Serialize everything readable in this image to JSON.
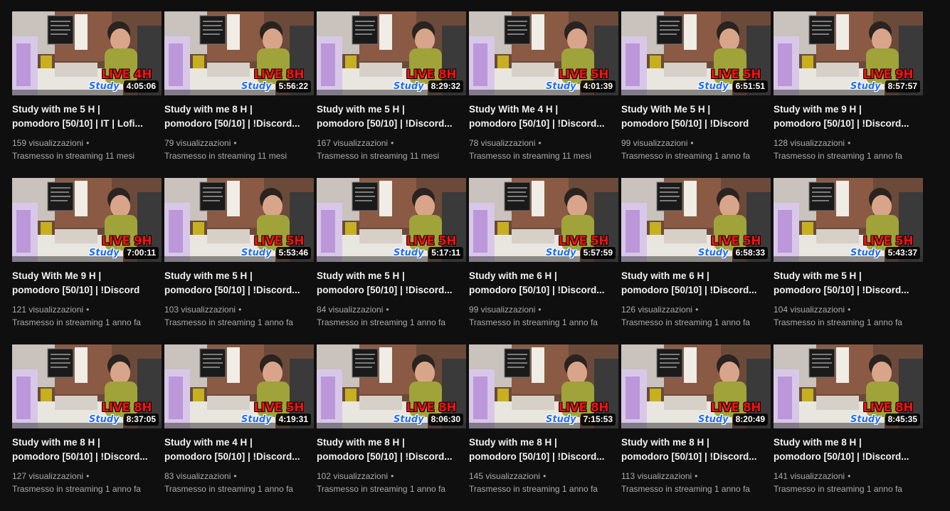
{
  "videos": [
    {
      "title": "Study with me 5 H | pomodoro [50/10] | IT | Lofi...",
      "live_label": "LIVE 4H",
      "brand": "Study",
      "duration": "4:05:06",
      "views": "159 visualizzazioni",
      "dot": "•",
      "streamed": "Trasmesso in streaming 11 mesi"
    },
    {
      "title": "Study with me 8 H | pomodoro [50/10] | !Discord...",
      "live_label": "LIVE 8H",
      "brand": "Study",
      "duration": "5:56:22",
      "views": "79 visualizzazioni",
      "dot": "•",
      "streamed": "Trasmesso in streaming 11 mesi"
    },
    {
      "title": "Study with me 5 H | pomodoro [50/10] | !Discord...",
      "live_label": "LIVE 8H",
      "brand": "Study",
      "duration": "8:29:32",
      "views": "167 visualizzazioni",
      "dot": "•",
      "streamed": "Trasmesso in streaming 11 mesi"
    },
    {
      "title": "Study With Me 4 H | pomodoro [50/10] | !Discord...",
      "live_label": "LIVE 5H",
      "brand": "Study",
      "duration": "4:01:39",
      "views": "78 visualizzazioni",
      "dot": "•",
      "streamed": "Trasmesso in streaming 11 mesi"
    },
    {
      "title": "Study With Me 5 H | pomodoro [50/10] | !Discord",
      "live_label": "LIVE 5H",
      "brand": "Study",
      "duration": "6:51:51",
      "views": "99 visualizzazioni",
      "dot": "•",
      "streamed": "Trasmesso in streaming 1 anno fa"
    },
    {
      "title": "Study with me 9 H | pomodoro [50/10] | !Discord...",
      "live_label": "LIVE 9H",
      "brand": "Study",
      "duration": "8:57:57",
      "views": "128 visualizzazioni",
      "dot": "•",
      "streamed": "Trasmesso in streaming 1 anno fa"
    },
    {
      "title": "Study With Me 9 H | pomodoro [50/10] | !Discord",
      "live_label": "LIVE 9H",
      "brand": "Study",
      "duration": "7:00:11",
      "views": "121 visualizzazioni",
      "dot": "•",
      "streamed": "Trasmesso in streaming 1 anno fa"
    },
    {
      "title": "Study with me 5 H | pomodoro [50/10] | !Discord...",
      "live_label": "LIVE 5H",
      "brand": "Study",
      "duration": "5:53:46",
      "views": "103 visualizzazioni",
      "dot": "•",
      "streamed": "Trasmesso in streaming 1 anno fa"
    },
    {
      "title": "Study with me 5 H | pomodoro [50/10] | !Discord...",
      "live_label": "LIVE 5H",
      "brand": "Study",
      "duration": "5:17:11",
      "views": "84 visualizzazioni",
      "dot": "•",
      "streamed": "Trasmesso in streaming 1 anno fa"
    },
    {
      "title": "Study with me 6 H | pomodoro [50/10] | !Discord...",
      "live_label": "LIVE 5H",
      "brand": "Study",
      "duration": "5:57:59",
      "views": "99 visualizzazioni",
      "dot": "•",
      "streamed": "Trasmesso in streaming 1 anno fa"
    },
    {
      "title": "Study with me 6 H | pomodoro [50/10] | !Discord...",
      "live_label": "LIVE 5H",
      "brand": "Study",
      "duration": "6:58:33",
      "views": "126 visualizzazioni",
      "dot": "•",
      "streamed": "Trasmesso in streaming 1 anno fa"
    },
    {
      "title": "Study with me 5 H | pomodoro [50/10] | !Discord...",
      "live_label": "LIVE 5H",
      "brand": "Study",
      "duration": "5:43:37",
      "views": "104 visualizzazioni",
      "dot": "•",
      "streamed": "Trasmesso in streaming 1 anno fa"
    },
    {
      "title": "Study with me 8 H | pomodoro [50/10] | !Discord...",
      "live_label": "LIVE 8H",
      "brand": "Study",
      "duration": "8:37:05",
      "views": "127 visualizzazioni",
      "dot": "•",
      "streamed": "Trasmesso in streaming 1 anno fa"
    },
    {
      "title": "Study with me 4 H | pomodoro [50/10] | !Discord...",
      "live_label": "LIVE 5H",
      "brand": "Study",
      "duration": "4:19:31",
      "views": "83 visualizzazioni",
      "dot": "•",
      "streamed": "Trasmesso in streaming 1 anno fa"
    },
    {
      "title": "Study with me 8 H | pomodoro [50/10] | !Discord...",
      "live_label": "LIVE 8H",
      "brand": "Study",
      "duration": "8:06:30",
      "views": "102 visualizzazioni",
      "dot": "•",
      "streamed": "Trasmesso in streaming 1 anno fa"
    },
    {
      "title": "Study with me 8 H | pomodoro [50/10] | !Discord...",
      "live_label": "LIVE 8H",
      "brand": "Study",
      "duration": "7:15:53",
      "views": "145 visualizzazioni",
      "dot": "•",
      "streamed": "Trasmesso in streaming 1 anno fa"
    },
    {
      "title": "Study with me 8 H | pomodoro [50/10] | !Discord...",
      "live_label": "LIVE 8H",
      "brand": "Study",
      "duration": "8:20:49",
      "views": "113 visualizzazioni",
      "dot": "•",
      "streamed": "Trasmesso in streaming 1 anno fa"
    },
    {
      "title": "Study with me 8 H | pomodoro [50/10] | !Discord...",
      "live_label": "LIVE 8H",
      "brand": "Study",
      "duration": "8:45:35",
      "views": "141 visualizzazioni",
      "dot": "•",
      "streamed": "Trasmesso in streaming 1 anno fa"
    }
  ],
  "colors": {
    "background": "#0f0f0f",
    "title_text": "#f1f1f1",
    "meta_text": "#aaaaaa",
    "live_red": "#ff1010",
    "study_blue": "#1e6bff"
  },
  "icons": {
    "thumbnail": "study-room-photo"
  }
}
